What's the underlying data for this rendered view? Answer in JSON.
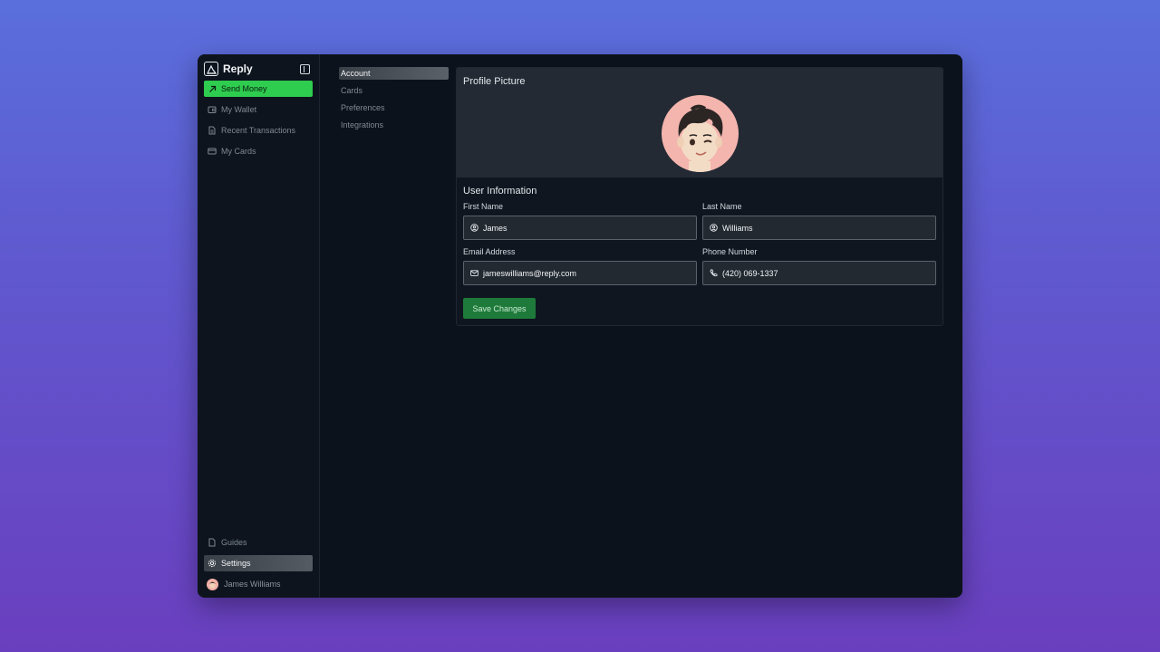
{
  "brand": {
    "name": "Reply"
  },
  "sidebar": {
    "items": [
      {
        "label": "Send Money",
        "icon": "arrow-up-right-icon"
      },
      {
        "label": "My Wallet",
        "icon": "wallet-icon"
      },
      {
        "label": "Recent Transactions",
        "icon": "document-icon"
      },
      {
        "label": "My Cards",
        "icon": "card-icon"
      }
    ],
    "bottom": [
      {
        "label": "Guides",
        "icon": "file-icon"
      },
      {
        "label": "Settings",
        "icon": "gear-icon"
      }
    ],
    "user": {
      "name": "James Williams"
    }
  },
  "subnav": {
    "items": [
      "Account",
      "Cards",
      "Preferences",
      "Integrations"
    ],
    "active": "Account"
  },
  "profile": {
    "title": "Profile Picture"
  },
  "info": {
    "title": "User Information",
    "first_name": {
      "label": "First Name",
      "value": "James"
    },
    "last_name": {
      "label": "Last Name",
      "value": "Williams"
    },
    "email": {
      "label": "Email Address",
      "value": "jameswilliams@reply.com"
    },
    "phone": {
      "label": "Phone Number",
      "value": "(420) 069-1337"
    },
    "save_label": "Save Changes"
  },
  "colors": {
    "accent_green": "#2ecc4f",
    "save_green": "#1e7a3a",
    "avatar_bg": "#f4b5ae"
  }
}
